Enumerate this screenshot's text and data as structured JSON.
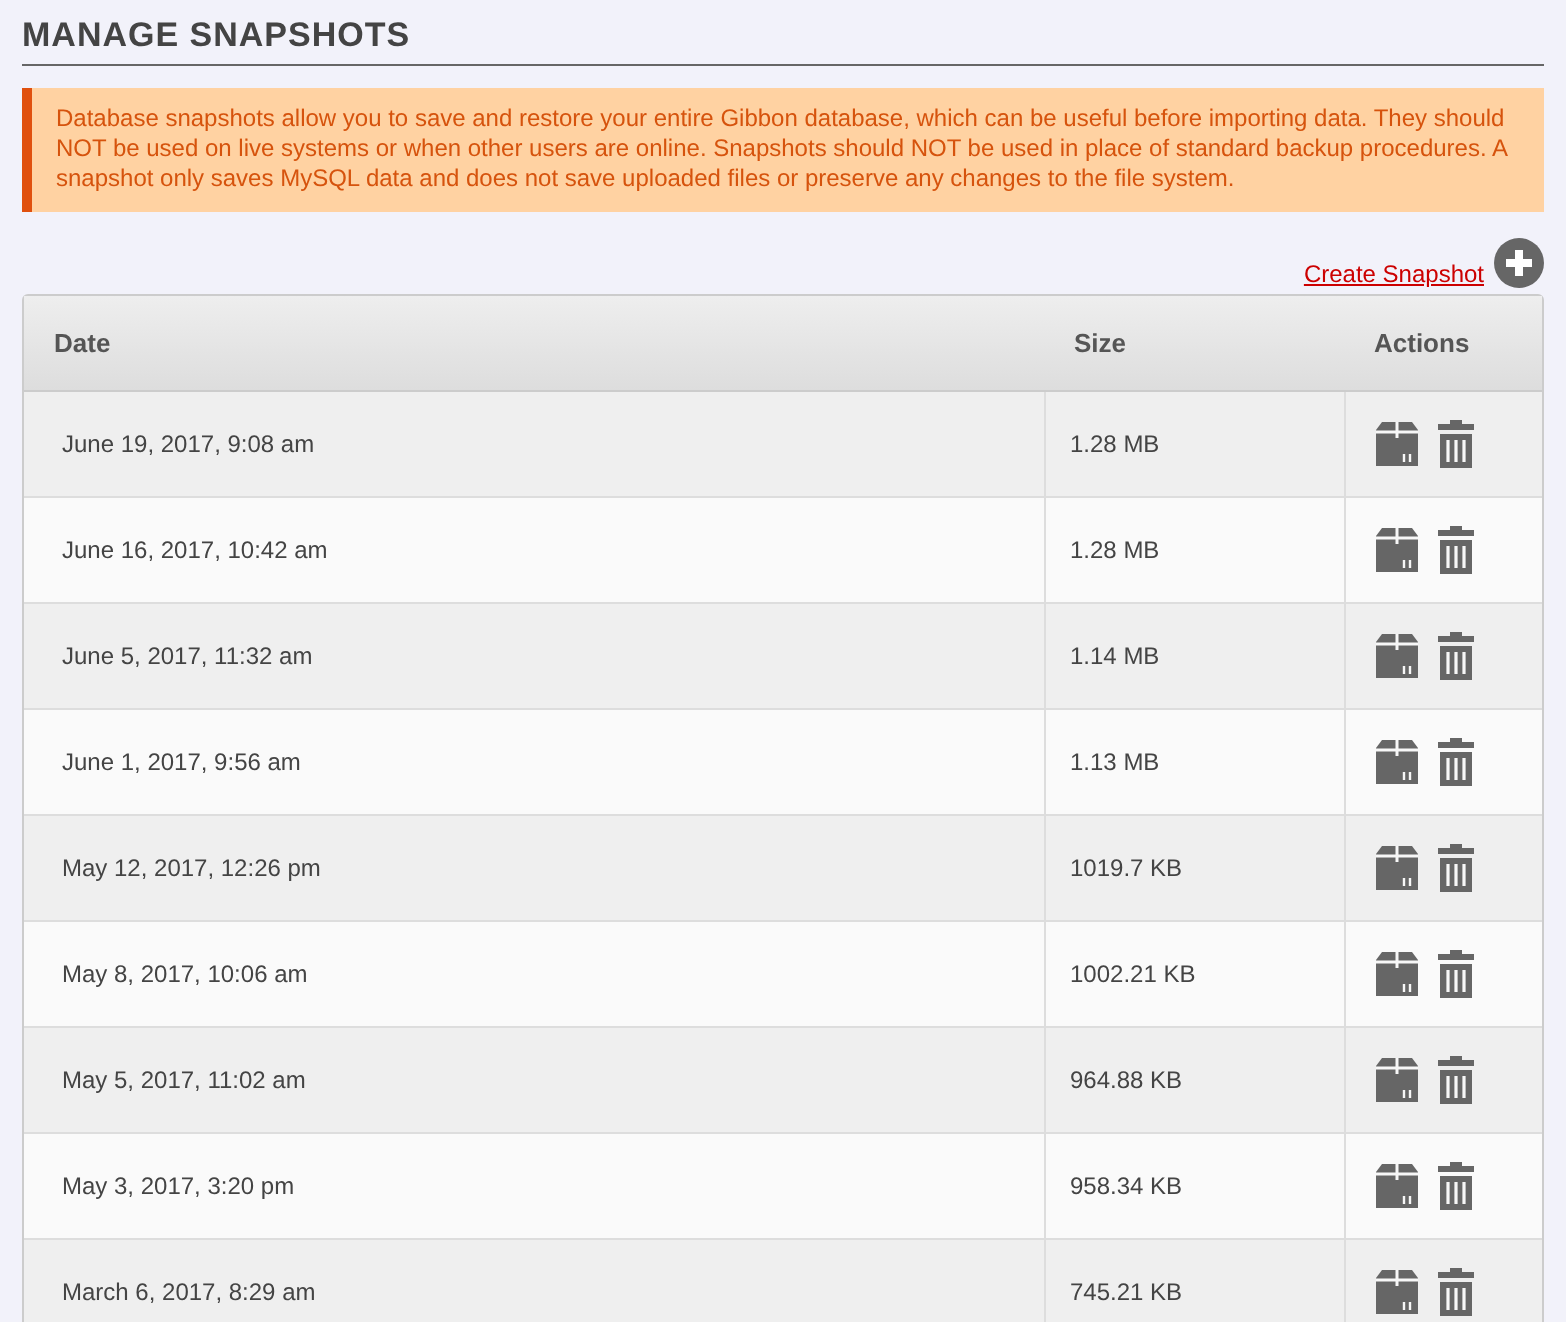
{
  "title": "MANAGE SNAPSHOTS",
  "alert": "Database snapshots allow you to save and restore your entire Gibbon database, which can be useful before importing data. They should NOT be used on live systems or when other users are online. Snapshots should NOT be used in place of standard backup procedures. A snapshot only saves MySQL data and does not save uploaded files or preserve any changes to the file system.",
  "create_link": "Create Snapshot",
  "table": {
    "columns": [
      "Date",
      "Size",
      "Actions"
    ],
    "rows": [
      {
        "date": "June 19, 2017, 9:08 am",
        "size": "1.28 MB"
      },
      {
        "date": "June 16, 2017, 10:42 am",
        "size": "1.28 MB"
      },
      {
        "date": "June 5, 2017, 11:32 am",
        "size": "1.14 MB"
      },
      {
        "date": "June 1, 2017, 9:56 am",
        "size": "1.13 MB"
      },
      {
        "date": "May 12, 2017, 12:26 pm",
        "size": "1019.7 KB"
      },
      {
        "date": "May 8, 2017, 10:06 am",
        "size": "1002.21 KB"
      },
      {
        "date": "May 5, 2017, 11:02 am",
        "size": "964.88 KB"
      },
      {
        "date": "May 3, 2017, 3:20 pm",
        "size": "958.34 KB"
      },
      {
        "date": "March 6, 2017, 8:29 am",
        "size": "745.21 KB"
      }
    ]
  }
}
